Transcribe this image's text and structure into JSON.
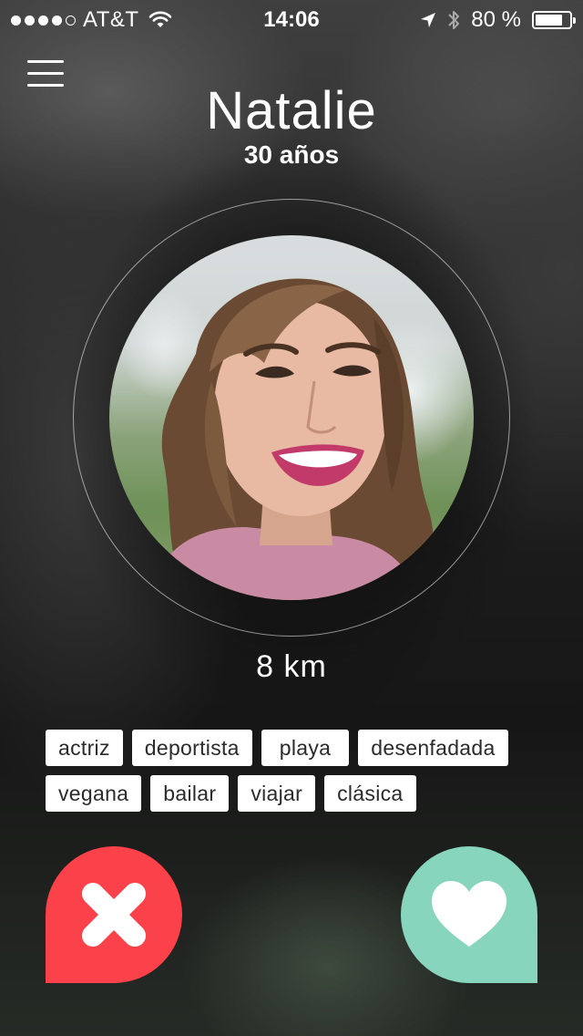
{
  "status_bar": {
    "carrier": "AT&T",
    "time": "14:06",
    "battery": "80 %",
    "battery_level": 0.8,
    "signal_bars_filled": 4,
    "signal_bars_total": 5
  },
  "profile": {
    "name": "Natalie",
    "age": "30 años",
    "distance": "8 km"
  },
  "tags": [
    [
      "actriz",
      "deportista",
      "playa",
      "desenfadada"
    ],
    [
      "vegana",
      "bailar",
      "viajar",
      "clásica"
    ]
  ],
  "actions": {
    "dislike_icon": "close-x-icon",
    "like_icon": "heart-icon"
  },
  "colors": {
    "dislike": "#fb4149",
    "like": "#88d5bd"
  }
}
